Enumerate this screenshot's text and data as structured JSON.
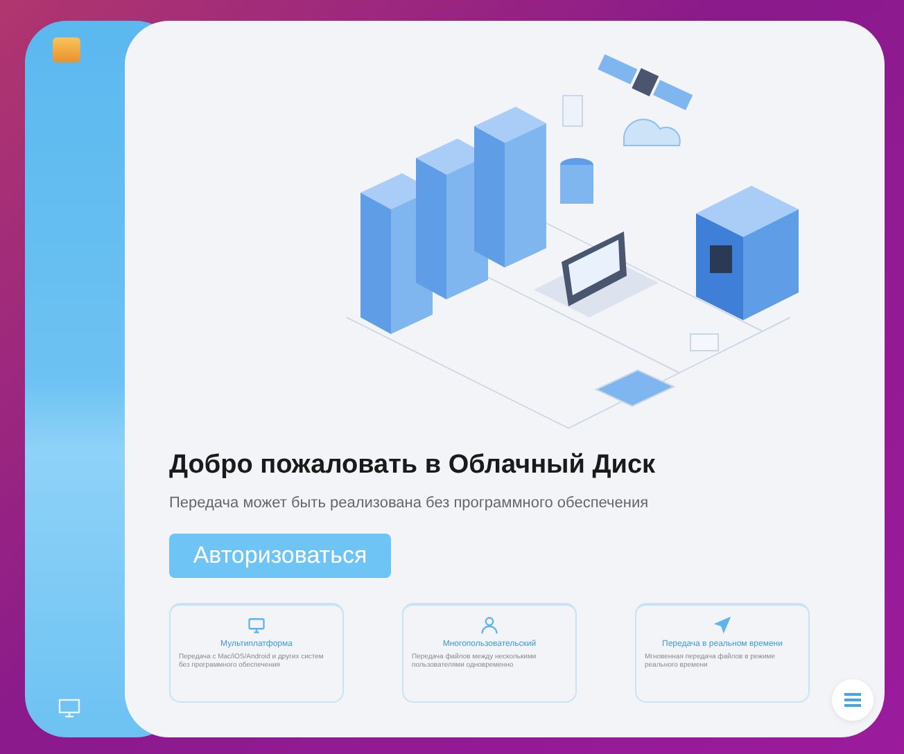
{
  "welcome": {
    "title": "Добро пожаловать в Облачный Диск",
    "subtitle": "Передача может быть реализована без программного обеспечения",
    "login_button": "Авторизоваться"
  },
  "features": [
    {
      "kind": "devices",
      "title": "Мультиплатформа",
      "text": "Передача с Mac/iOS/Android и других систем без программного обеспечения"
    },
    {
      "kind": "user",
      "title": "Многопользовательский",
      "text": "Передача файлов между несколькими пользователями одновременно"
    },
    {
      "kind": "send",
      "title": "Передача в реальном времени",
      "text": "Мгновенная передача файлов в режиме реального времени"
    }
  ]
}
